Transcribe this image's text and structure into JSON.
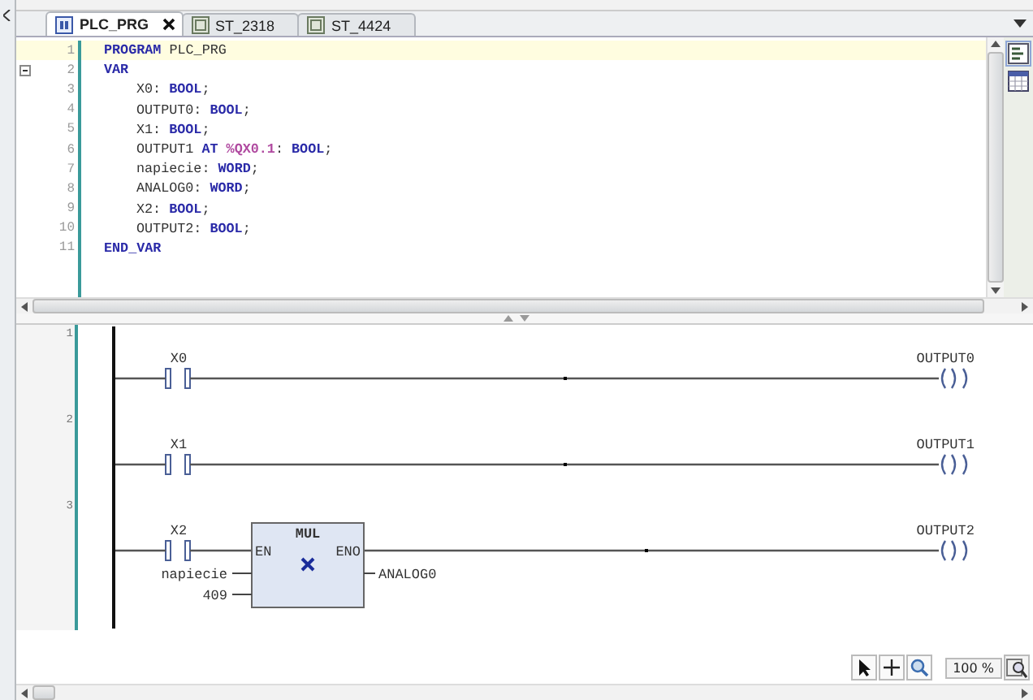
{
  "tabs": [
    {
      "label": "PLC_PRG",
      "kind": "program",
      "selected": true,
      "closable": true
    },
    {
      "label": "ST_2318",
      "kind": "object",
      "selected": false,
      "closable": false
    },
    {
      "label": "ST_4424",
      "kind": "object",
      "selected": false,
      "closable": false
    }
  ],
  "code": {
    "lines": [
      {
        "number": "1",
        "current": true,
        "indent": false,
        "tokens": [
          {
            "text": "PROGRAM",
            "kind": "keyword"
          },
          {
            "text": " PLC_PRG",
            "kind": "plain"
          }
        ]
      },
      {
        "number": "2",
        "current": false,
        "fold": {
          "expanded": true
        },
        "indent": false,
        "tokens": [
          {
            "text": "VAR",
            "kind": "keyword"
          }
        ]
      },
      {
        "number": "3",
        "current": false,
        "indent": true,
        "tokens": [
          {
            "text": "X0: ",
            "kind": "plain"
          },
          {
            "text": "BOOL",
            "kind": "keyword"
          },
          {
            "text": ";",
            "kind": "plain"
          }
        ]
      },
      {
        "number": "4",
        "current": false,
        "indent": true,
        "tokens": [
          {
            "text": "OUTPUT0: ",
            "kind": "plain"
          },
          {
            "text": "BOOL",
            "kind": "keyword"
          },
          {
            "text": ";",
            "kind": "plain"
          }
        ]
      },
      {
        "number": "5",
        "current": false,
        "indent": true,
        "tokens": [
          {
            "text": "X1: ",
            "kind": "plain"
          },
          {
            "text": "BOOL",
            "kind": "keyword"
          },
          {
            "text": ";",
            "kind": "plain"
          }
        ]
      },
      {
        "number": "6",
        "current": false,
        "indent": true,
        "tokens": [
          {
            "text": "OUTPUT1 ",
            "kind": "plain"
          },
          {
            "text": "AT",
            "kind": "keyword"
          },
          {
            "text": " %QX0.1",
            "kind": "address"
          },
          {
            "text": ": ",
            "kind": "plain"
          },
          {
            "text": "BOOL",
            "kind": "keyword"
          },
          {
            "text": ";",
            "kind": "plain"
          }
        ]
      },
      {
        "number": "7",
        "current": false,
        "indent": true,
        "tokens": [
          {
            "text": "napiecie: ",
            "kind": "plain"
          },
          {
            "text": "WORD",
            "kind": "keyword"
          },
          {
            "text": ";",
            "kind": "plain"
          }
        ]
      },
      {
        "number": "8",
        "current": false,
        "indent": true,
        "tokens": [
          {
            "text": "ANALOG0: ",
            "kind": "plain"
          },
          {
            "text": "WORD",
            "kind": "keyword"
          },
          {
            "text": ";",
            "kind": "plain"
          }
        ]
      },
      {
        "number": "9",
        "current": false,
        "indent": true,
        "tokens": [
          {
            "text": "X2: ",
            "kind": "plain"
          },
          {
            "text": "BOOL",
            "kind": "keyword"
          },
          {
            "text": ";",
            "kind": "plain"
          }
        ]
      },
      {
        "number": "10",
        "current": false,
        "indent": true,
        "tokens": [
          {
            "text": "OUTPUT2: ",
            "kind": "plain"
          },
          {
            "text": "BOOL",
            "kind": "keyword"
          },
          {
            "text": ";",
            "kind": "plain"
          }
        ]
      },
      {
        "number": "11",
        "current": false,
        "indent": false,
        "tokens": [
          {
            "text": "END_VAR",
            "kind": "keyword"
          }
        ]
      }
    ]
  },
  "ladder": {
    "networks": [
      {
        "number": "1",
        "contact": "X0",
        "coil": "OUTPUT0"
      },
      {
        "number": "2",
        "contact": "X1",
        "coil": "OUTPUT1"
      },
      {
        "number": "3",
        "contact": "X2",
        "coil": "OUTPUT2",
        "block": {
          "title": "MUL",
          "input_pin": "EN",
          "output_pin": "ENO",
          "inputs": [
            "napiecie",
            "409"
          ],
          "output": "ANALOG0"
        }
      }
    ]
  },
  "zoom": {
    "value": "100 %"
  }
}
